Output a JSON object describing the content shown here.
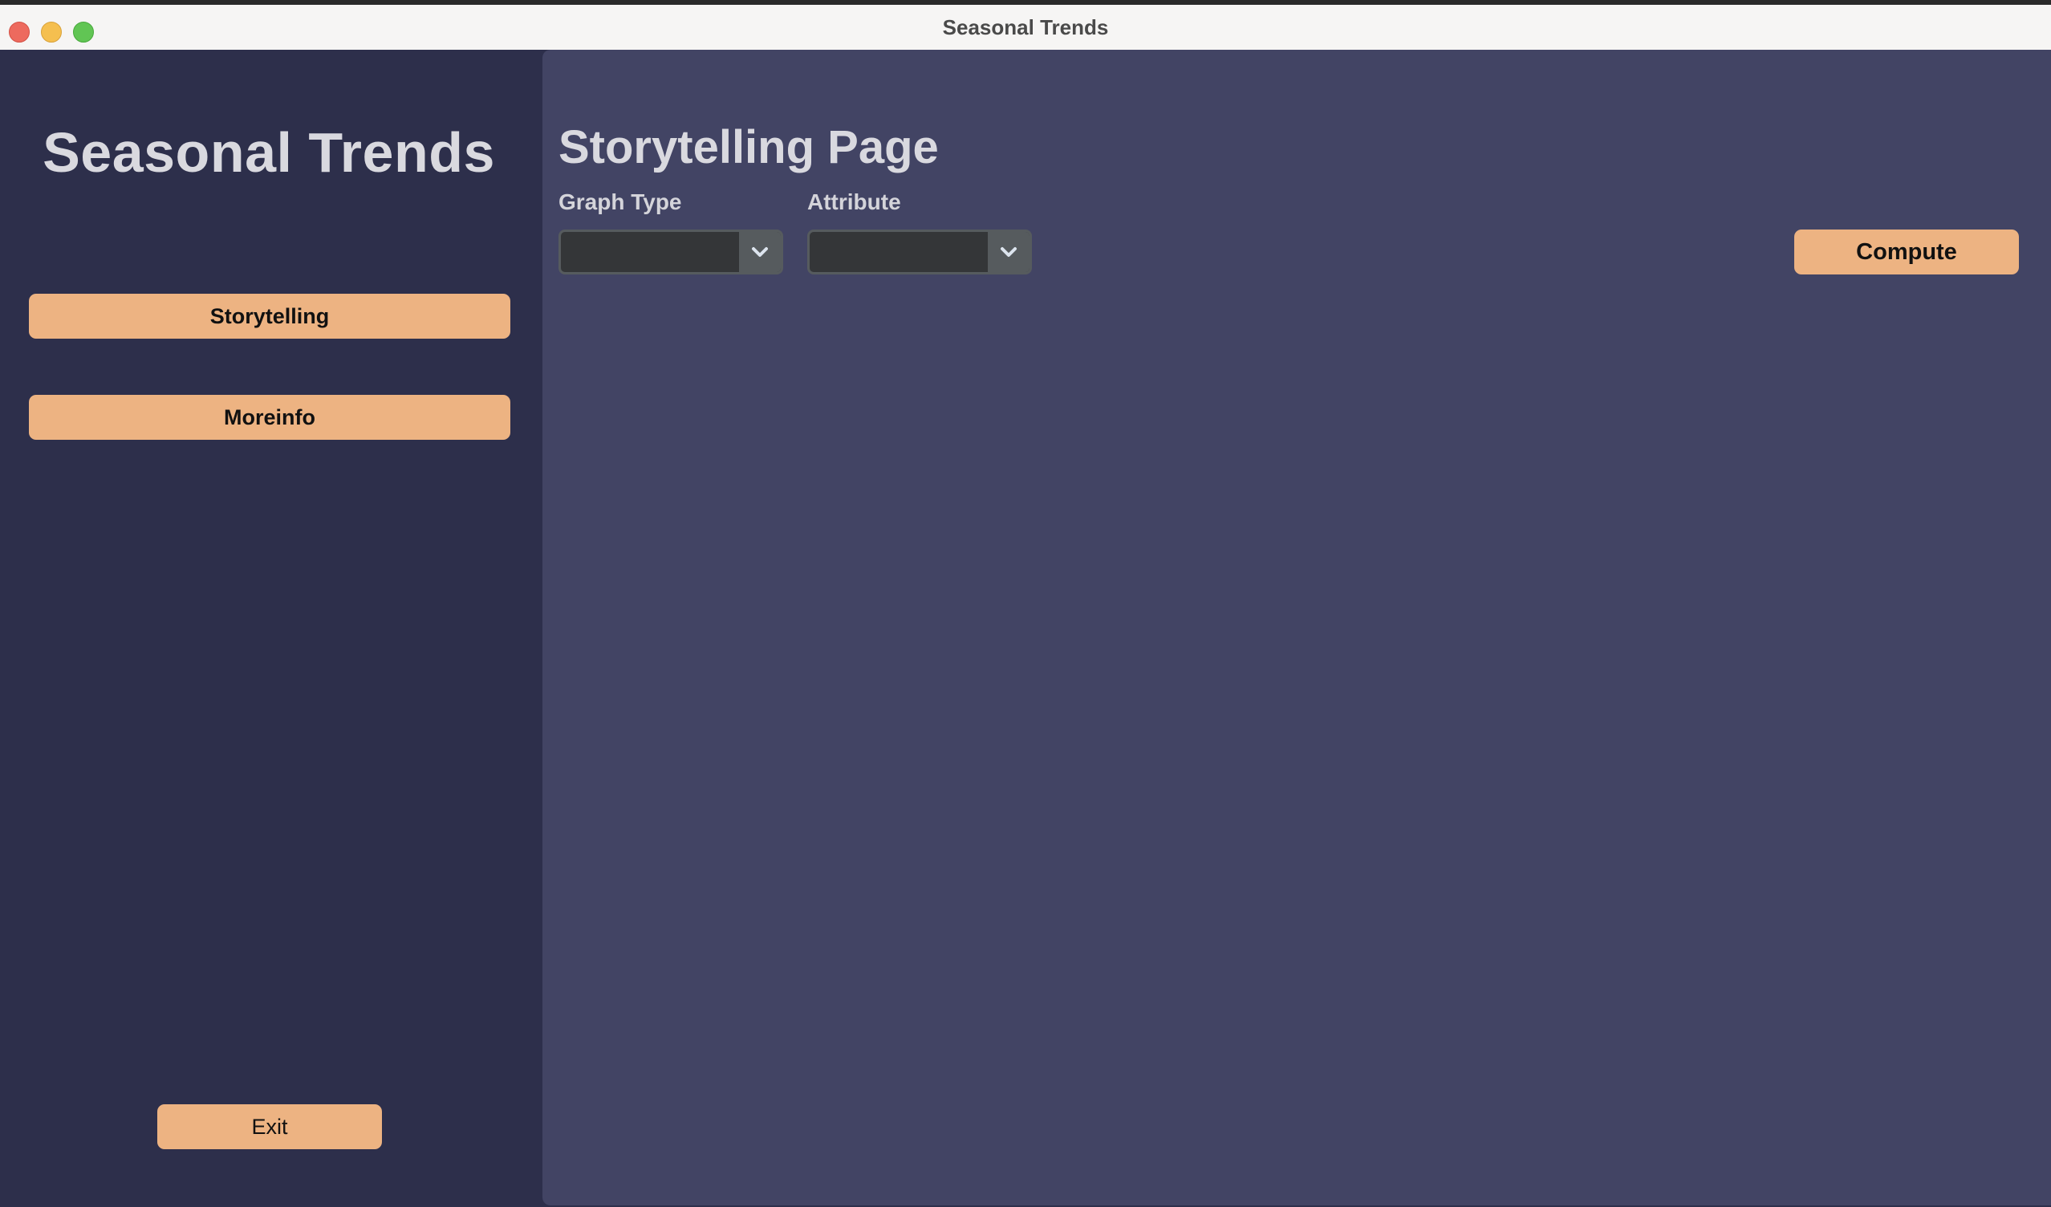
{
  "window": {
    "title": "Seasonal Trends"
  },
  "sidebar": {
    "app_title": "Seasonal Trends",
    "items": [
      {
        "label": "Storytelling"
      },
      {
        "label": "Moreinfo"
      }
    ],
    "exit_label": "Exit"
  },
  "main": {
    "page_title": "Storytelling Page",
    "graph_type": {
      "label": "Graph Type",
      "value": ""
    },
    "attribute": {
      "label": "Attribute",
      "value": ""
    },
    "compute_label": "Compute"
  },
  "icons": {
    "close": "close-icon",
    "minimize": "minimize-icon",
    "maximize": "maximize-icon",
    "dropdown": "chevron-down-icon"
  },
  "colors": {
    "sidebar_bg": "#2d2f4b",
    "main_bg": "#424464",
    "button_bg": "#edb382",
    "dropdown_bg": "#343638",
    "dropdown_arrow_bg": "#565b5e"
  }
}
